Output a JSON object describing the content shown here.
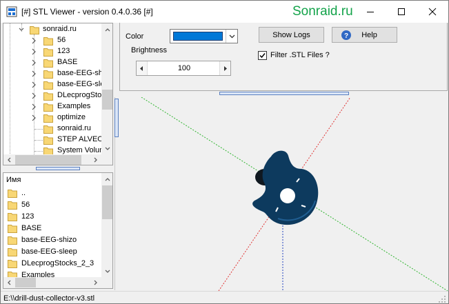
{
  "window": {
    "title": "[#] STL Viewer - version 0.4.0.36 [#]",
    "watermark": "Sonraid.ru",
    "caption_buttons": [
      "minimize-icon",
      "maximize-icon",
      "close-icon"
    ]
  },
  "tree": {
    "root": {
      "label": "sonraid.ru",
      "expanded": true
    },
    "items": [
      {
        "label": "56",
        "expandable": true
      },
      {
        "label": "123",
        "expandable": true
      },
      {
        "label": "BASE",
        "expandable": true
      },
      {
        "label": "base-EEG-shiz",
        "expandable": true
      },
      {
        "label": "base-EEG-slee",
        "expandable": true
      },
      {
        "label": "DLecprogStock",
        "expandable": true
      },
      {
        "label": "Examples",
        "expandable": true
      },
      {
        "label": "optimize",
        "expandable": true
      },
      {
        "label": "sonraid.ru",
        "expandable": false
      },
      {
        "label": "STEP ALVEOC",
        "expandable": false
      },
      {
        "label": "System Volum",
        "expandable": false
      }
    ]
  },
  "file_list": {
    "header": "Имя",
    "items": [
      "..",
      "56",
      "123",
      "BASE",
      "base-EEG-shizo",
      "base-EEG-sleep",
      "DLecprogStocks_2_3",
      "Examples"
    ]
  },
  "controls": {
    "color_label": "Color",
    "color_value": "#0078d7",
    "brightness_label": "Brightness",
    "brightness_value": "100",
    "show_logs_label": "Show Logs",
    "help_label": "Help",
    "filter_label": "Filter .STL Files ?",
    "filter_checked": true
  },
  "viewer": {
    "model_color": "#0d3a5e",
    "axis_colors": {
      "x": "#e03030",
      "y": "#2cb42c",
      "z": "#2040c0"
    }
  },
  "status": {
    "path": "E:\\\\drill-dust-collector-v3.stl"
  }
}
